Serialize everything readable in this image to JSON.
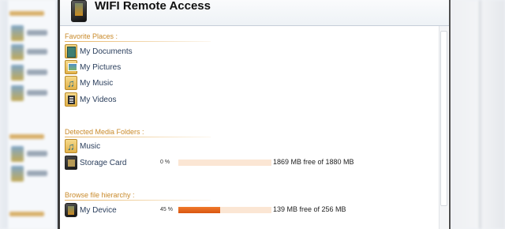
{
  "app": {
    "title": "WIFI Remote Access",
    "icon": "device-icon"
  },
  "sections": {
    "favorites": {
      "heading": "Favorite Places :",
      "items": [
        {
          "label": "My Documents",
          "icon": "documents-folder-icon"
        },
        {
          "label": "My Pictures",
          "icon": "pictures-folder-icon"
        },
        {
          "label": "My Music",
          "icon": "music-folder-icon"
        },
        {
          "label": "My Videos",
          "icon": "videos-folder-icon"
        }
      ]
    },
    "media": {
      "heading": "Detected Media Folders :",
      "items": [
        {
          "label": "Music",
          "icon": "music-folder-icon"
        },
        {
          "label": "Storage Card",
          "icon": "storage-card-icon",
          "percent_label": "0 %",
          "used_fraction": 0.0,
          "free_label": "1869 MB free of 1880 MB"
        }
      ]
    },
    "browse": {
      "heading": "Browse file hierarchy :",
      "items": [
        {
          "label": "My Device",
          "icon": "device-icon",
          "percent_label": "45 %",
          "used_fraction": 0.45,
          "free_label": "139 MB free of 256 MB"
        }
      ]
    }
  },
  "colors": {
    "heading": "#c98a2a",
    "link": "#2a3e5c",
    "bar_fill": "#e8651c",
    "bar_track": "#fbe6d4"
  }
}
